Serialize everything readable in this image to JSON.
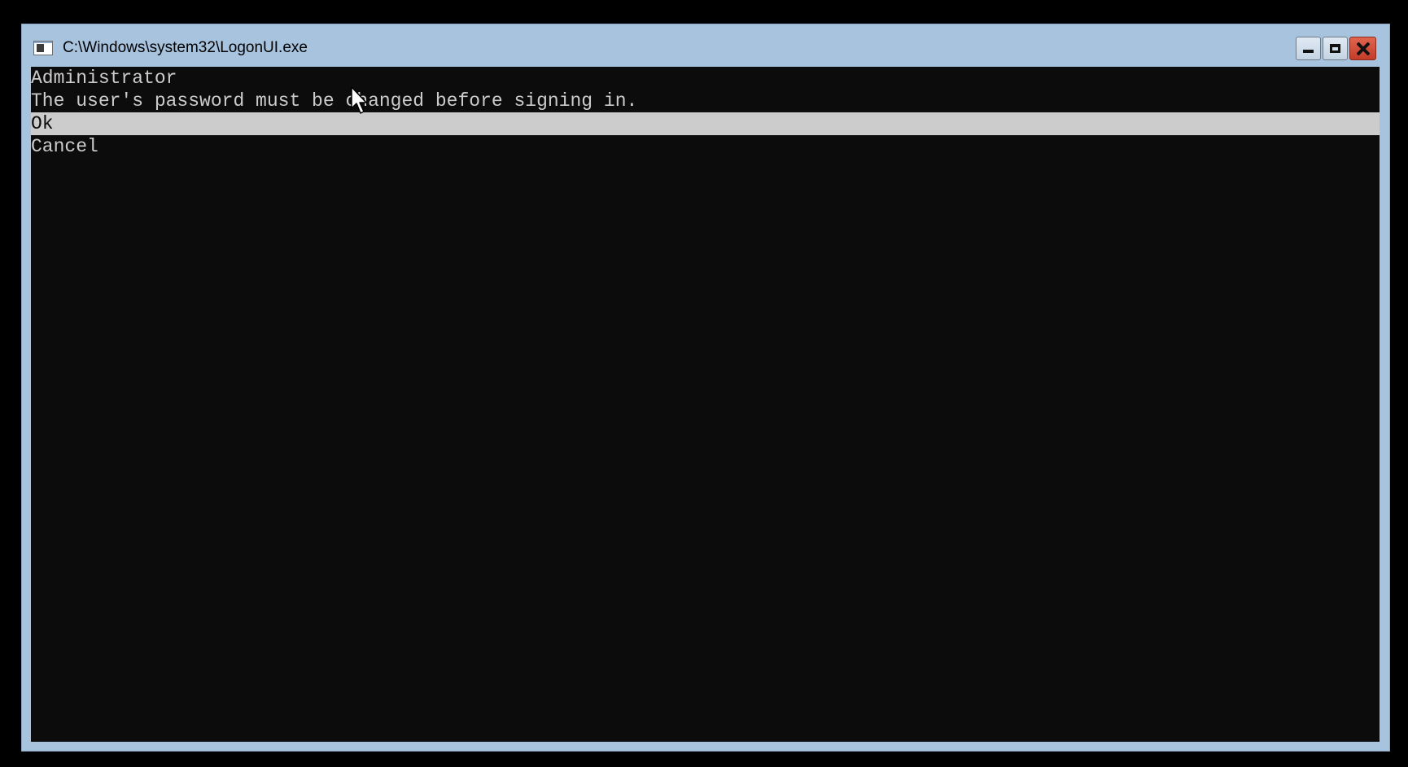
{
  "window": {
    "title": "C:\\Windows\\system32\\LogonUI.exe",
    "icon": "console-app-icon",
    "controls": {
      "minimize": "minimize-icon",
      "maximize": "maximize-icon",
      "close": "close-icon"
    }
  },
  "console": {
    "username": "Administrator",
    "message": "The user's password must be changed before signing in.",
    "options": [
      {
        "label": "Ok",
        "selected": true
      },
      {
        "label": "Cancel",
        "selected": false
      }
    ],
    "colors": {
      "background": "#0c0c0c",
      "foreground": "#cccccc",
      "highlight": "#cccccc"
    }
  }
}
